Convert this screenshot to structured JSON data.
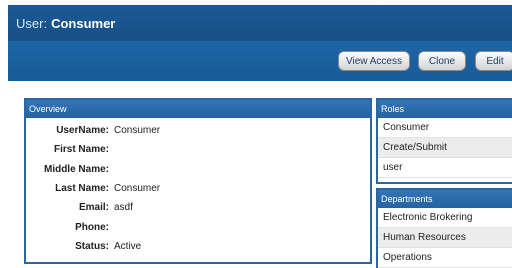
{
  "title": {
    "label": "User:",
    "value": "Consumer"
  },
  "toolbar": {
    "view_access": "View Access",
    "clone": "Clone",
    "edit": "Edit"
  },
  "overview": {
    "header": "Overview",
    "fields": [
      {
        "label": "UserName:",
        "value": "Consumer"
      },
      {
        "label": "First Name:",
        "value": ""
      },
      {
        "label": "Middle Name:",
        "value": ""
      },
      {
        "label": "Last Name:",
        "value": "Consumer"
      },
      {
        "label": "Email:",
        "value": "asdf"
      },
      {
        "label": "Phone:",
        "value": ""
      },
      {
        "label": "Status:",
        "value": "Active"
      }
    ]
  },
  "roles": {
    "header": "Roles",
    "items": [
      "Consumer",
      "Create/Submit",
      "user"
    ]
  },
  "departments": {
    "header": "Departments",
    "items": [
      "Electronic Brokering",
      "Human Resources",
      "Operations"
    ]
  }
}
